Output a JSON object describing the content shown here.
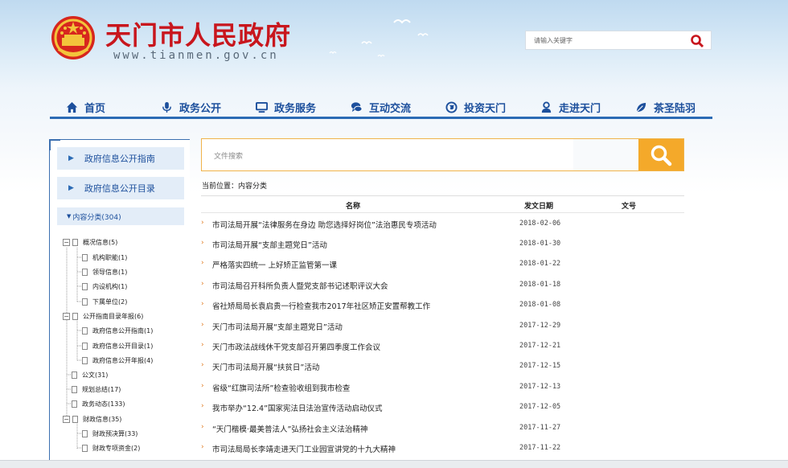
{
  "header": {
    "site_title": "天门市人民政府",
    "site_domain": "www.tianmen.gov.cn",
    "search_placeholder": "请输入关键字"
  },
  "nav": [
    {
      "label": "首页",
      "icon": "home-icon"
    },
    {
      "label": "政务公开",
      "icon": "microphone-icon"
    },
    {
      "label": "政务服务",
      "icon": "monitor-icon"
    },
    {
      "label": "互动交流",
      "icon": "chat-icon"
    },
    {
      "label": "投资天门",
      "icon": "globe-icon"
    },
    {
      "label": "走进天门",
      "icon": "person-icon"
    },
    {
      "label": "茶圣陆羽",
      "icon": "leaf-icon"
    }
  ],
  "sidebar": {
    "guide": "政府信息公开指南",
    "catalog": "政府信息公开目录",
    "category": "内容分类(304)",
    "tree": [
      {
        "label": "概况信息(5)",
        "level": 0
      },
      {
        "label": "机构职能(1)",
        "level": 1
      },
      {
        "label": "领导信息(1)",
        "level": 1
      },
      {
        "label": "内设机构(1)",
        "level": 1
      },
      {
        "label": "下属单位(2)",
        "level": 1
      },
      {
        "label": "公开指南目录年报(6)",
        "level": 0
      },
      {
        "label": "政府信息公开指南(1)",
        "level": 1
      },
      {
        "label": "政府信息公开目录(1)",
        "level": 1
      },
      {
        "label": "政府信息公开年报(4)",
        "level": 1
      },
      {
        "label": "公文(31)",
        "level": 0
      },
      {
        "label": "规划总结(17)",
        "level": 0
      },
      {
        "label": "政务动态(133)",
        "level": 0
      },
      {
        "label": "财政信息(35)",
        "level": 0
      },
      {
        "label": "财政预决算(33)",
        "level": 1
      },
      {
        "label": "财政专项资金(2)",
        "level": 1
      }
    ]
  },
  "main": {
    "search_label": "文件搜索",
    "breadcrumb": "当前位置：内容分类",
    "columns": {
      "name": "名称",
      "date": "发文日期",
      "number": "文号"
    },
    "rows": [
      {
        "title": "市司法局开展“法律服务在身边 助您选择好岗位”法治惠民专项活动",
        "date": "2018-02-06"
      },
      {
        "title": "市司法局开展“支部主题党日”活动",
        "date": "2018-01-30"
      },
      {
        "title": "严格落实四统一 上好矫正监管第一课",
        "date": "2018-01-22"
      },
      {
        "title": "市司法局召开科所负责人暨党支部书记述职评议大会",
        "date": "2018-01-18"
      },
      {
        "title": "省社矫局局长袁启贵一行检查我市2017年社区矫正安置帮教工作",
        "date": "2018-01-08"
      },
      {
        "title": "天门市司法局开展“支部主题党日”活动",
        "date": "2017-12-29"
      },
      {
        "title": "天门市政法战线休干党支部召开第四季度工作会议",
        "date": "2017-12-21"
      },
      {
        "title": "天门市司法局开展“扶贫日”活动",
        "date": "2017-12-15"
      },
      {
        "title": "省级“红旗司法所”检查验收组到我市检查",
        "date": "2017-12-13"
      },
      {
        "title": "我市举办“12.4”国家宪法日法治宣传活动启动仪式",
        "date": "2017-12-05"
      },
      {
        "title": "“天门楷模·最美普法人”弘扬社会主义法治精神",
        "date": "2017-11-27"
      },
      {
        "title": "市司法局局长李靖走进天门工业园宣讲党的十九大精神",
        "date": "2017-11-22"
      }
    ]
  },
  "colors": {
    "nav_text": "#1c4f9c",
    "title_red": "#c8161d",
    "search_orange": "#f4a92a",
    "bullet": "#e07a20"
  }
}
